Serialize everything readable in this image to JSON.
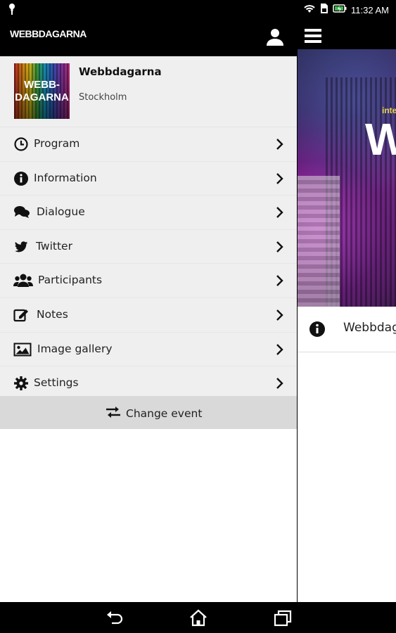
{
  "status_bar": {
    "time": "11:32 AM"
  },
  "header": {
    "brand": "WEBBDAGARNA"
  },
  "drawer": {
    "event": {
      "logo_text_line1": "WEBB-",
      "logo_text_line2": "DAGARNA",
      "name": "Webbdagarna",
      "city": "Stockholm"
    },
    "menu": [
      {
        "label": "Program",
        "icon": "clock-icon"
      },
      {
        "label": "Information",
        "icon": "info-icon"
      },
      {
        "label": "Dialogue",
        "icon": "comments-icon"
      },
      {
        "label": "Twitter",
        "icon": "twitter-icon"
      },
      {
        "label": "Participants",
        "icon": "users-icon"
      },
      {
        "label": "Notes",
        "icon": "edit-icon"
      },
      {
        "label": "Image gallery",
        "icon": "image-icon"
      },
      {
        "label": "Settings",
        "icon": "gear-icon"
      }
    ],
    "change_event": "Change event"
  },
  "content": {
    "info_text": "Webbdag",
    "hero_big": "W",
    "hero_small": "inte"
  },
  "colors": {
    "bar": "#000000",
    "drawer_bg": "#efefef",
    "change_event_bg": "#d9d9d9"
  }
}
